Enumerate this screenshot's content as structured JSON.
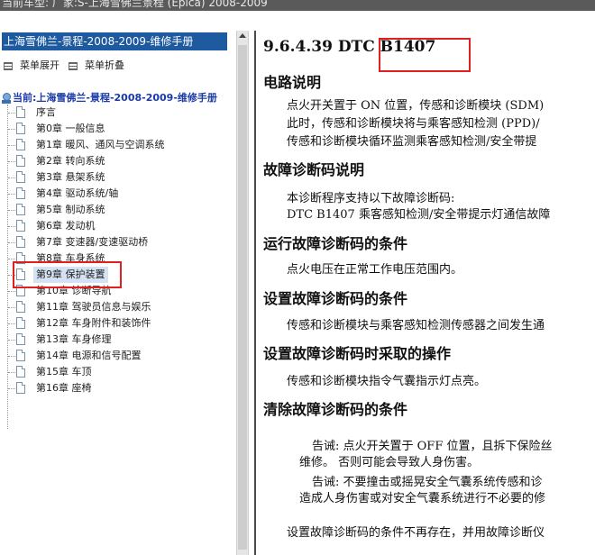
{
  "window": {
    "title": "当前车型: 厂家:S-上海雪佛兰景程 (Epica) 2008-2009"
  },
  "sidebar": {
    "header": "上海雪佛兰-景程-2008-2009-维修手册",
    "expand_label": "菜单展开",
    "collapse_label": "菜单折叠",
    "root_label": "当前:上海雪佛兰-景程-2008-2009-维修手册",
    "items": [
      {
        "label": "序言"
      },
      {
        "label": "第0章 一般信息"
      },
      {
        "label": "第1章 暖风、通风与空调系统"
      },
      {
        "label": "第2章 转向系统"
      },
      {
        "label": "第3章 悬架系统"
      },
      {
        "label": "第4章 驱动系统/轴"
      },
      {
        "label": "第5章 制动系统"
      },
      {
        "label": "第6章 发动机"
      },
      {
        "label": "第7章 变速器/变速驱动桥"
      },
      {
        "label": "第8章 车身系统"
      },
      {
        "label": "第9章 保护装置"
      },
      {
        "label": "第10章 诊断导航"
      },
      {
        "label": "第11章 驾驶员信息与娱乐"
      },
      {
        "label": "第12章 车身附件和装饰件"
      },
      {
        "label": "第13章 车身修理"
      },
      {
        "label": "第14章 电源和信号配置"
      },
      {
        "label": "第15章 车顶"
      },
      {
        "label": "第16章 座椅"
      }
    ],
    "selected_index": 10
  },
  "content": {
    "title": "9.6.4.39 DTC B1407",
    "sections": [
      {
        "heading": "电路说明",
        "lines": [
          "点火开关置于 ON 位置，传感和诊断模块 (SDM)",
          "此时，传感和诊断模块将与乘客感知检测 (PPD)/",
          "传感和诊断模块循环监测乘客感知检测/安全带提"
        ]
      },
      {
        "heading": "故障诊断码说明",
        "lines": [
          "本诊断程序支持以下故障诊断码:",
          "DTC B1407 乘客感知检测/安全带提示灯通信故障"
        ]
      },
      {
        "heading": "运行故障诊断码的条件",
        "lines": [
          "点火电压在正常工作电压范围内。"
        ]
      },
      {
        "heading": "设置故障诊断码的条件",
        "lines": [
          "传感和诊断模块与乘客感知检测传感器之间发生通"
        ]
      },
      {
        "heading": "设置故障诊断码时采取的操作",
        "lines": [
          "传感和诊断模块指令气囊指示灯点亮。"
        ]
      },
      {
        "heading": "清除故障诊断码的条件",
        "lines": [
          "告诫: 点火开关置于 OFF 位置，且拆下保险丝",
          "维修。 否则可能会导致人身伤害。",
          "告诫: 不要撞击或摇晃安全气囊系统传感和诊",
          "造成人身伤害或对安全气囊系统进行不必要的修",
          "设置故障诊断码的条件不再存在，并用故障诊断仪"
        ]
      }
    ]
  }
}
